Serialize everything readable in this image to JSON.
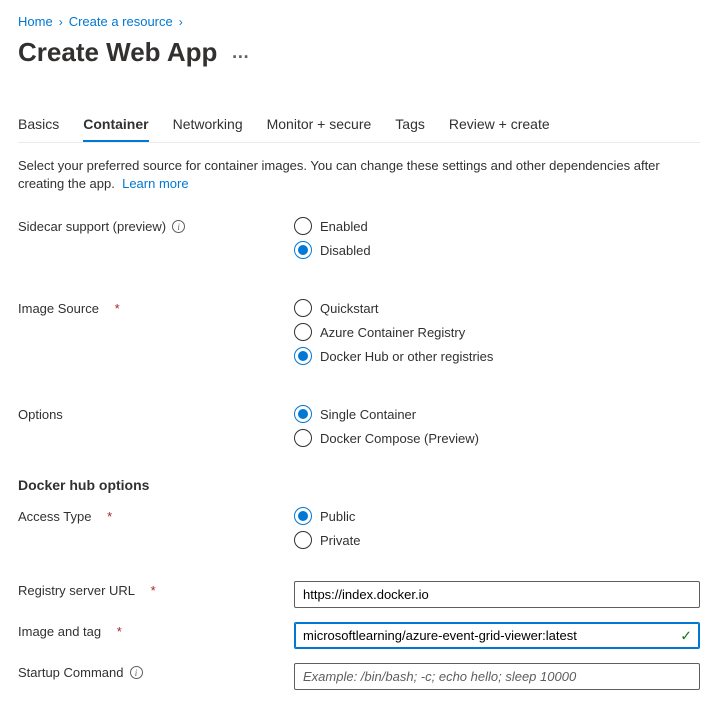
{
  "breadcrumb": {
    "home": "Home",
    "create_resource": "Create a resource"
  },
  "page_title": "Create Web App",
  "tabs": {
    "basics": "Basics",
    "container": "Container",
    "networking": "Networking",
    "monitor": "Monitor + secure",
    "tags": "Tags",
    "review": "Review + create"
  },
  "description": {
    "text": "Select your preferred source for container images. You can change these settings and other dependencies after creating the app.",
    "learn_more": "Learn more"
  },
  "sidecar": {
    "label": "Sidecar support (preview)",
    "enabled": "Enabled",
    "disabled": "Disabled",
    "selected": "disabled"
  },
  "image_source": {
    "label": "Image Source",
    "quickstart": "Quickstart",
    "acr": "Azure Container Registry",
    "dockerhub": "Docker Hub or other registries",
    "selected": "dockerhub"
  },
  "options": {
    "label": "Options",
    "single": "Single Container",
    "compose": "Docker Compose (Preview)",
    "selected": "single"
  },
  "docker_hub_heading": "Docker hub options",
  "access_type": {
    "label": "Access Type",
    "public": "Public",
    "private": "Private",
    "selected": "public"
  },
  "registry_url": {
    "label": "Registry server URL",
    "value": "https://index.docker.io"
  },
  "image_tag": {
    "label": "Image and tag",
    "value": "microsoftlearning/azure-event-grid-viewer:latest"
  },
  "startup_command": {
    "label": "Startup Command",
    "placeholder": "Example: /bin/bash; -c; echo hello; sleep 10000",
    "value": ""
  }
}
